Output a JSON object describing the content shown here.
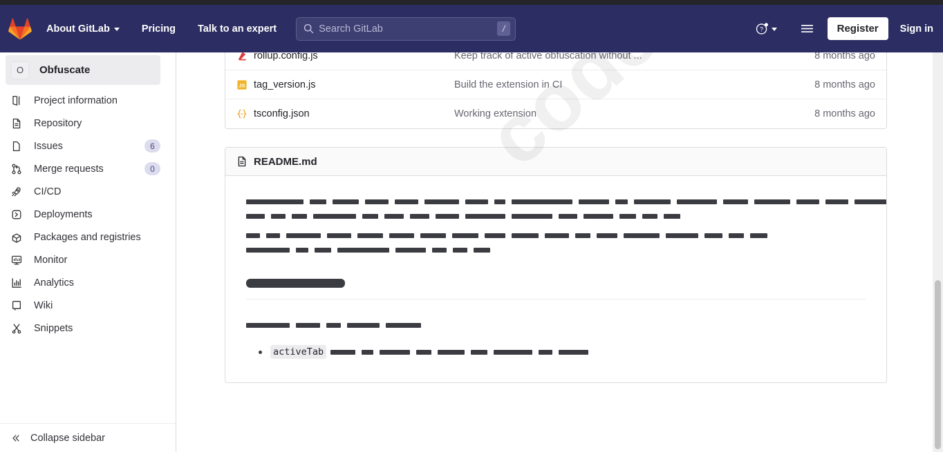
{
  "header": {
    "logo_icon": "gitlab-fox-logo",
    "nav": [
      {
        "label": "About GitLab",
        "has_caret": true
      },
      {
        "label": "Pricing",
        "has_caret": false
      },
      {
        "label": "Talk to an expert",
        "has_caret": false
      }
    ],
    "search": {
      "placeholder": "Search GitLab",
      "shortcut": "/",
      "icon": "search-icon"
    },
    "help_icon": "help-question-icon",
    "menu_icon": "hamburger-menu-icon",
    "register_label": "Register",
    "signin_label": "Sign in",
    "bg_color": "#2c2d62"
  },
  "sidebar": {
    "project": {
      "avatar_letter": "O",
      "name": "Obfuscate"
    },
    "items": [
      {
        "label": "Project information",
        "icon": "book-icon",
        "badge": null
      },
      {
        "label": "Repository",
        "icon": "document-icon",
        "badge": null
      },
      {
        "label": "Issues",
        "icon": "issue-icon",
        "badge": "6"
      },
      {
        "label": "Merge requests",
        "icon": "merge-request-icon",
        "badge": "0"
      },
      {
        "label": "CI/CD",
        "icon": "rocket-icon",
        "badge": null
      },
      {
        "label": "Deployments",
        "icon": "deployments-icon",
        "badge": null
      },
      {
        "label": "Packages and registries",
        "icon": "package-icon",
        "badge": null
      },
      {
        "label": "Monitor",
        "icon": "monitor-icon",
        "badge": null
      },
      {
        "label": "Analytics",
        "icon": "chart-icon",
        "badge": null
      },
      {
        "label": "Wiki",
        "icon": "book-open-icon",
        "badge": null
      },
      {
        "label": "Snippets",
        "icon": "snippet-scissors-icon",
        "badge": null
      }
    ],
    "collapse_label": "Collapse sidebar",
    "collapse_icon": "double-chevron-left-icon"
  },
  "files": {
    "columns": [
      "name",
      "commit_message",
      "last_update"
    ],
    "rows": [
      {
        "name": "rollup.config.js",
        "icon": "rollup-file-icon",
        "icon_color": "#e23a3a",
        "message": "Keep track of active obfuscation without ...",
        "time": "8 months ago"
      },
      {
        "name": "tag_version.js",
        "icon": "javascript-file-icon",
        "icon_color": "#f0b429",
        "message": "Build the extension in CI",
        "time": "8 months ago"
      },
      {
        "name": "tsconfig.json",
        "icon": "json-file-icon",
        "icon_color": "#f0a429",
        "message": "Working extension",
        "time": "8 months ago"
      }
    ]
  },
  "readme": {
    "title": "README.md",
    "icon": "readme-document-icon",
    "redacted": true,
    "paragraphs": [
      {
        "lines": [
          [
            83,
            24,
            38,
            34,
            34,
            50,
            33,
            16,
            88,
            44,
            18,
            53,
            58,
            36,
            52,
            33,
            33,
            46,
            36,
            52,
            37,
            22,
            20,
            25
          ],
          [
            27,
            21,
            22,
            62,
            23,
            28,
            28,
            34,
            58,
            59,
            27,
            43,
            24,
            22,
            24
          ]
        ]
      },
      {
        "lines": [
          [
            20,
            20,
            50,
            35,
            37,
            36,
            37,
            38,
            30,
            39,
            35,
            22,
            30,
            52,
            47,
            26,
            22,
            25
          ],
          [
            63,
            18,
            24,
            75,
            44,
            21,
            21,
            24
          ]
        ]
      }
    ],
    "heading_bar_width": 143,
    "subparagraph": [
      63,
      35,
      21,
      47,
      51
    ],
    "bullet": {
      "code": "activeTab",
      "bars": [
        36,
        17,
        44,
        22,
        39,
        24,
        56,
        20,
        43
      ]
    }
  },
  "watermark": {
    "text": "codeby.net"
  },
  "scrollbar": {
    "visible": true
  }
}
